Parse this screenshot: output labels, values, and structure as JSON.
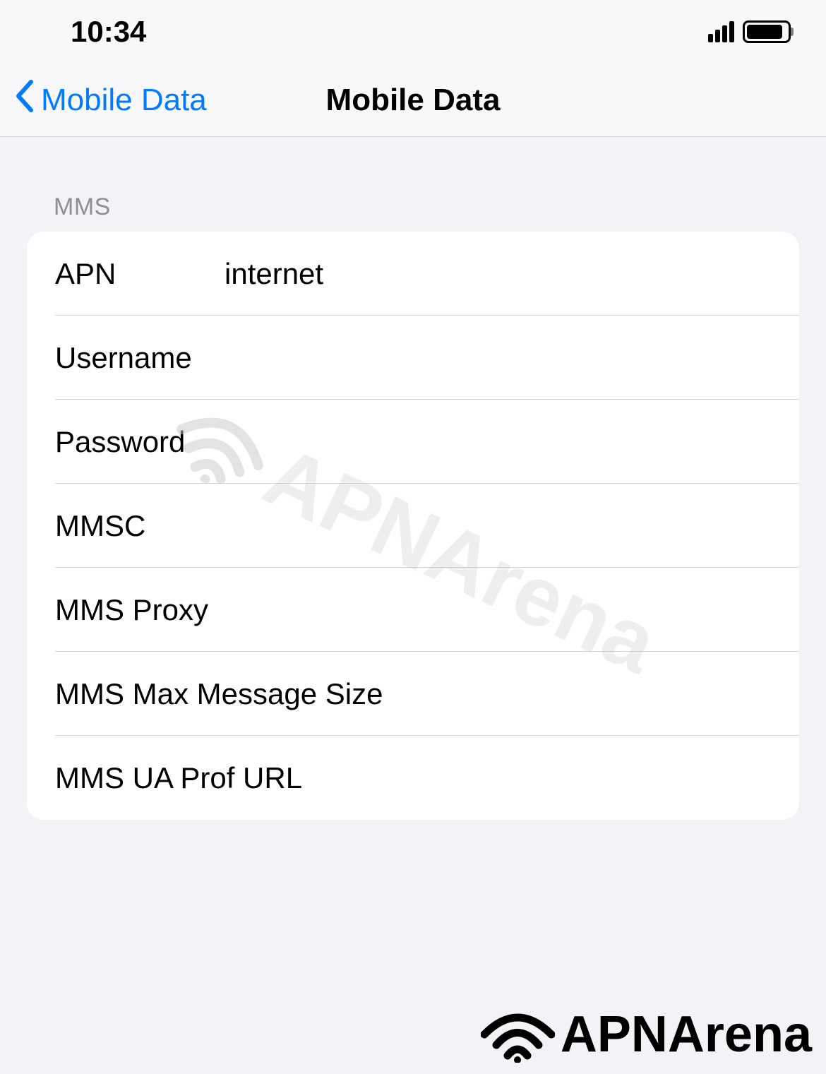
{
  "status_bar": {
    "time": "10:34"
  },
  "nav": {
    "back_label": "Mobile Data",
    "title": "Mobile Data"
  },
  "section": {
    "header": "MMS",
    "rows": [
      {
        "label": "APN",
        "value": "internet"
      },
      {
        "label": "Username",
        "value": ""
      },
      {
        "label": "Password",
        "value": ""
      },
      {
        "label": "MMSC",
        "value": ""
      },
      {
        "label": "MMS Proxy",
        "value": ""
      },
      {
        "label": "MMS Max Message Size",
        "value": ""
      },
      {
        "label": "MMS UA Prof URL",
        "value": ""
      }
    ]
  },
  "watermark": "APNArena",
  "footer": "APNArena"
}
